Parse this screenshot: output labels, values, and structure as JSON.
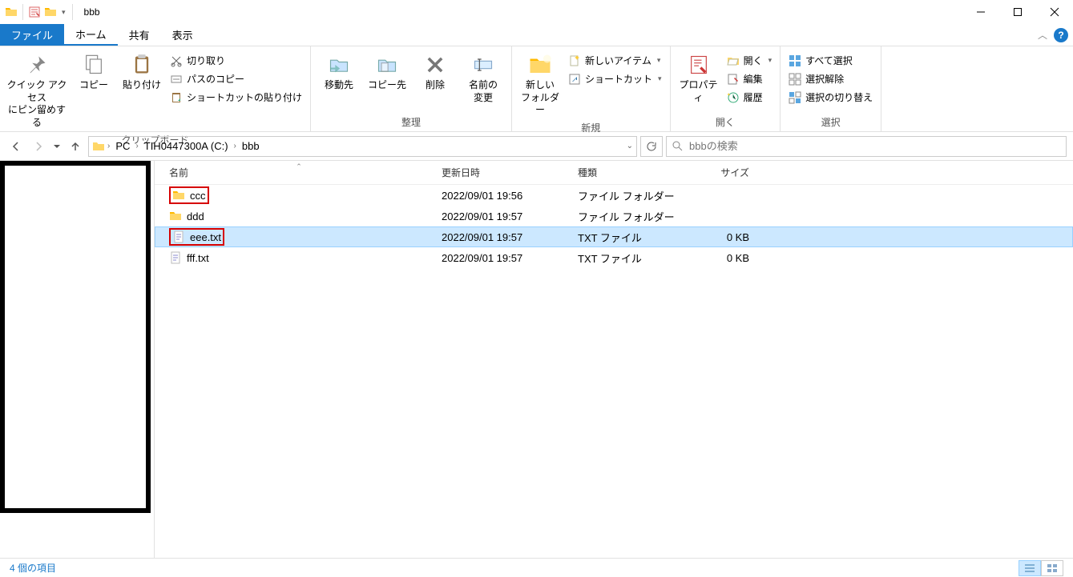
{
  "title": "bbb",
  "tabs": {
    "file": "ファイル",
    "home": "ホーム",
    "share": "共有",
    "view": "表示"
  },
  "ribbon": {
    "clipboard": {
      "label": "クリップボード",
      "pin": "クイック アクセス\nにピン留めする",
      "copy": "コピー",
      "paste": "貼り付け",
      "cut": "切り取り",
      "copy_path": "パスのコピー",
      "paste_shortcut": "ショートカットの貼り付け"
    },
    "organize": {
      "label": "整理",
      "move_to": "移動先",
      "copy_to": "コピー先",
      "delete": "削除",
      "rename": "名前の\n変更"
    },
    "new": {
      "label": "新規",
      "new_folder": "新しい\nフォルダー",
      "new_item": "新しいアイテム",
      "shortcut": "ショートカット"
    },
    "open": {
      "label": "開く",
      "properties": "プロパティ",
      "open": "開く",
      "edit": "編集",
      "history": "履歴"
    },
    "select": {
      "label": "選択",
      "select_all": "すべて選択",
      "select_none": "選択解除",
      "invert": "選択の切り替え"
    }
  },
  "breadcrumb": {
    "pc": "PC",
    "drive": "TIH0447300A (C:)",
    "folder": "bbb"
  },
  "search_placeholder": "bbbの検索",
  "columns": {
    "name": "名前",
    "date": "更新日時",
    "type": "種類",
    "size": "サイズ"
  },
  "items": [
    {
      "name": "ccc",
      "date": "2022/09/01 19:56",
      "type": "ファイル フォルダー",
      "size": "",
      "icon": "folder",
      "highlighted": true
    },
    {
      "name": "ddd",
      "date": "2022/09/01 19:57",
      "type": "ファイル フォルダー",
      "size": "",
      "icon": "folder",
      "highlighted": false
    },
    {
      "name": "eee.txt",
      "date": "2022/09/01 19:57",
      "type": "TXT ファイル",
      "size": "0 KB",
      "icon": "txt",
      "highlighted": true,
      "selected": true
    },
    {
      "name": "fff.txt",
      "date": "2022/09/01 19:57",
      "type": "TXT ファイル",
      "size": "0 KB",
      "icon": "txt",
      "highlighted": false
    }
  ],
  "status": "4 個の項目"
}
